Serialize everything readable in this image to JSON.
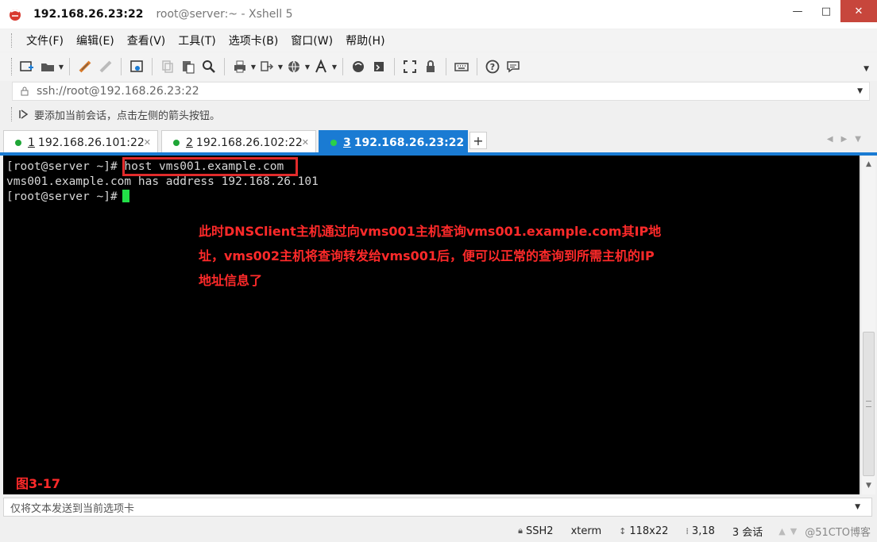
{
  "window": {
    "title": "192.168.26.23:22",
    "subtitle": "root@server:~ - Xshell 5",
    "min_label": "—",
    "max_label": "□",
    "close_label": "✕"
  },
  "menu": {
    "items": [
      "文件(F)",
      "编辑(E)",
      "查看(V)",
      "工具(T)",
      "选项卡(B)",
      "窗口(W)",
      "帮助(H)"
    ]
  },
  "toolbar": {
    "icons": [
      "new-session-icon",
      "open-folder-icon",
      "disconnect-icon",
      "reconnect-icon",
      "properties-icon",
      "copy-icon",
      "paste-icon",
      "find-icon",
      "print-icon",
      "transfer-icon",
      "globe-icon",
      "font-icon",
      "xftp-icon",
      "script-icon",
      "fullscreen-icon",
      "lock-icon",
      "keyboard-icon",
      "help-icon",
      "chat-icon"
    ]
  },
  "address": {
    "url": "ssh://root@192.168.26.23:22"
  },
  "hint": {
    "text": "要添加当前会话，点击左侧的箭头按钮。"
  },
  "tabs": [
    {
      "num": "1",
      "label": "192.168.26.101:22",
      "active": false
    },
    {
      "num": "2",
      "label": "192.168.26.102:22",
      "active": false
    },
    {
      "num": "3",
      "label": "192.168.26.23:22",
      "active": true
    }
  ],
  "tab_add_label": "+",
  "terminal": {
    "lines": [
      "[root@server ~]# host vms001.example.com",
      "vms001.example.com has address 192.168.26.101",
      "[root@server ~]#"
    ],
    "annotation_lines": [
      "此时DNSClient主机通过向vms001主机查询vms001.example.com其IP地",
      "址，vms002主机将查询转发给vms001后，便可以正常的查询到所需主机的IP",
      "地址信息了"
    ],
    "figure_label": "图3-17"
  },
  "sendbar": {
    "text": "仅将文本发送到当前选项卡"
  },
  "status": {
    "protocol": "SSH2",
    "term": "xterm",
    "size": "118x22",
    "cursor_pos": "3,18",
    "sessions": "3 会话",
    "watermark": "@51CTO博客"
  },
  "colors": {
    "tab_active": "#1a7bd3",
    "annotation": "#ff2a2a",
    "cursor": "#22e048",
    "close_button": "#c7463c"
  }
}
